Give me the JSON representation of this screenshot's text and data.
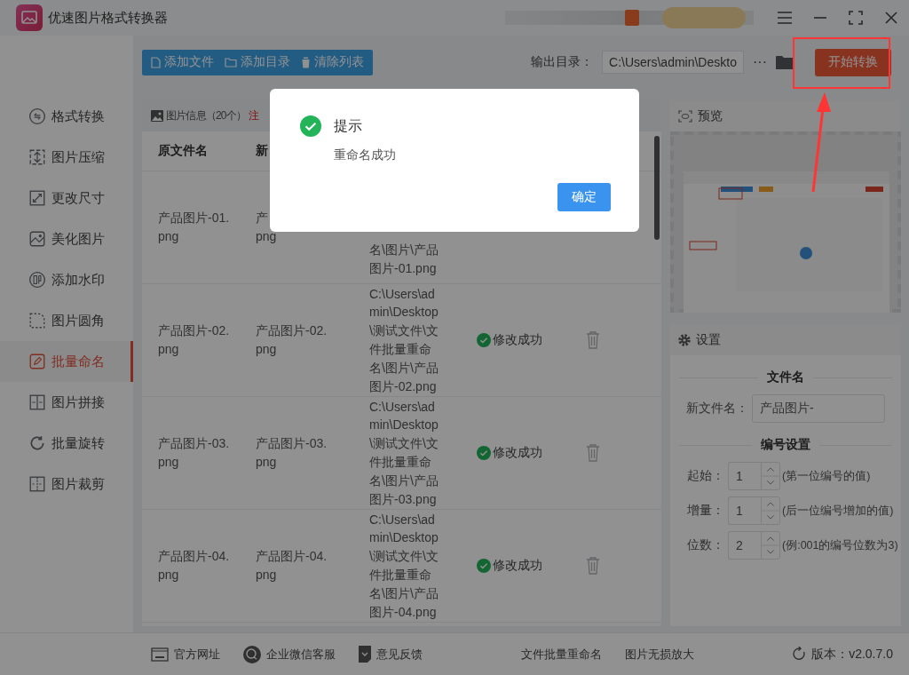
{
  "window": {
    "title": "优速图片格式转换器"
  },
  "toolbar": {
    "buttons": [
      "添加文件",
      "添加目录",
      "清除列表"
    ],
    "output_label": "输出目录：",
    "output_path": "C:\\Users\\admin\\Deskto",
    "more": "···",
    "start_button": "开始转换"
  },
  "sidebar": {
    "items": [
      {
        "label": "格式转换",
        "selected": false
      },
      {
        "label": "图片压缩",
        "selected": false
      },
      {
        "label": "更改尺寸",
        "selected": false
      },
      {
        "label": "美化图片",
        "selected": false
      },
      {
        "label": "添加水印",
        "selected": false
      },
      {
        "label": "图片圆角",
        "selected": false
      },
      {
        "label": "批量命名",
        "selected": true
      },
      {
        "label": "图片拼接",
        "selected": false
      },
      {
        "label": "批量旋转",
        "selected": false
      },
      {
        "label": "图片裁剪",
        "selected": false
      }
    ]
  },
  "file_panel": {
    "title": "图片信息（20个）",
    "notice": "注",
    "columns": [
      "原文件名",
      "新"
    ],
    "rows": [
      {
        "original": "产品图片-01.png",
        "new": "产\npng",
        "path": "名\\图片\\产品图片-01.png"
      },
      {
        "original": "产品图片-02.png",
        "new": "产品图片-02.png",
        "path": "C:\\Users\\admin\\Desktop\\测试文件\\文件批量重命名\\图片\\产品图片-02.png",
        "status": "修改成功"
      },
      {
        "original": "产品图片-03.png",
        "new": "产品图片-03.png",
        "path": "C:\\Users\\admin\\Desktop\\测试文件\\文件批量重命名\\图片\\产品图片-03.png",
        "status": "修改成功"
      },
      {
        "original": "产品图片-04.png",
        "new": "产品图片-04.png",
        "path": "C:\\Users\\admin\\Desktop\\测试文件\\文件批量重命名\\图片\\产品图片-04.png",
        "status": "修改成功"
      }
    ]
  },
  "preview": {
    "title": "预览",
    "kind": "picture"
  },
  "settings": {
    "title": "设置",
    "filename_section": "文件名",
    "new_name_label": "新文件名：",
    "new_name_value": "产品图片-",
    "numbering_section": "编号设置",
    "fields": [
      {
        "label": "起始：",
        "value": "1",
        "hint": "(第一位编号的值)"
      },
      {
        "label": "增量：",
        "value": "1",
        "hint": "(后一位编号增加的值)"
      },
      {
        "label": "位数：",
        "value": "2",
        "hint": "(例:001的编号位数为3)"
      }
    ]
  },
  "footer": {
    "links": [
      "官方网址",
      "企业微信客服",
      "意见反馈"
    ],
    "tools": [
      "文件批量重命名",
      "图片无损放大"
    ],
    "version": "版本：v2.0.7.0"
  },
  "dialog": {
    "title": "提示",
    "message": "重命名成功",
    "button": "确定"
  }
}
